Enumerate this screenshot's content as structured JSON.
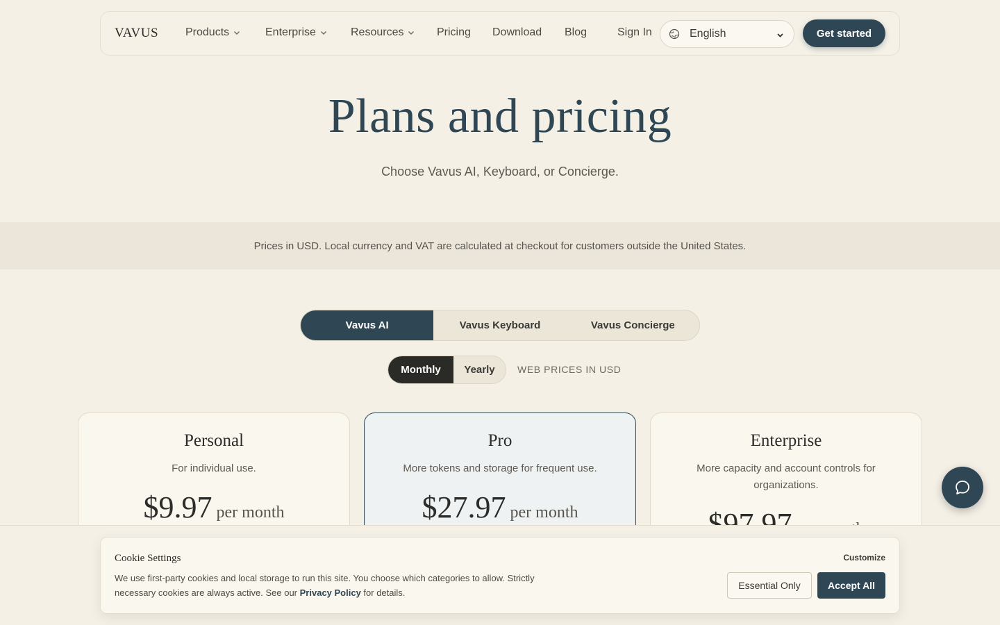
{
  "nav": {
    "logo": "VAVUS",
    "items": [
      {
        "label": "Products",
        "has_dropdown": true
      },
      {
        "label": "Enterprise",
        "has_dropdown": true
      },
      {
        "label": "Resources",
        "has_dropdown": true
      },
      {
        "label": "Pricing",
        "has_dropdown": false
      },
      {
        "label": "Download",
        "has_dropdown": false
      },
      {
        "label": "Blog",
        "has_dropdown": false
      }
    ],
    "sign_in": "Sign In",
    "language": {
      "selected": "English",
      "icon": "globe-icon"
    },
    "cta": "Get started"
  },
  "hero": {
    "title": "Plans and pricing",
    "subtitle": "Choose Vavus AI, Keyboard, or Concierge."
  },
  "notice": "Prices in USD. Local currency and VAT are calculated at checkout for customers outside the United States.",
  "product_tabs": [
    {
      "label": "Vavus AI",
      "active": true
    },
    {
      "label": "Vavus Keyboard",
      "active": false
    },
    {
      "label": "Vavus Concierge",
      "active": false
    }
  ],
  "billing": {
    "monthly": "Monthly",
    "yearly": "Yearly",
    "selected": "Monthly",
    "note": "WEB PRICES IN USD"
  },
  "plans": [
    {
      "name": "Personal",
      "description": "For individual use.",
      "price": "$9.97",
      "period": "per month",
      "highlighted": false
    },
    {
      "name": "Pro",
      "description": "More tokens and storage for frequent use.",
      "price": "$27.97",
      "period": "per month",
      "highlighted": true
    },
    {
      "name": "Enterprise",
      "description": "More capacity and account controls for organizations.",
      "price": "$97.97",
      "period": "per month",
      "highlighted": false
    }
  ],
  "cookie": {
    "title": "Cookie Settings",
    "text_before": "We use first-party cookies and local storage to run this site. You choose which categories to allow. Strictly necessary cookies are always active. See our ",
    "link": "Privacy Policy",
    "text_after": " for details.",
    "customize": "Customize",
    "essential": "Essential Only",
    "accept": "Accept All"
  },
  "chat": {
    "icon": "chat-bubble-icon"
  },
  "colors": {
    "background": "#f5f0e6",
    "primary": "#2f4754",
    "dark": "#2a2a27",
    "notice_band": "#ece6da"
  }
}
